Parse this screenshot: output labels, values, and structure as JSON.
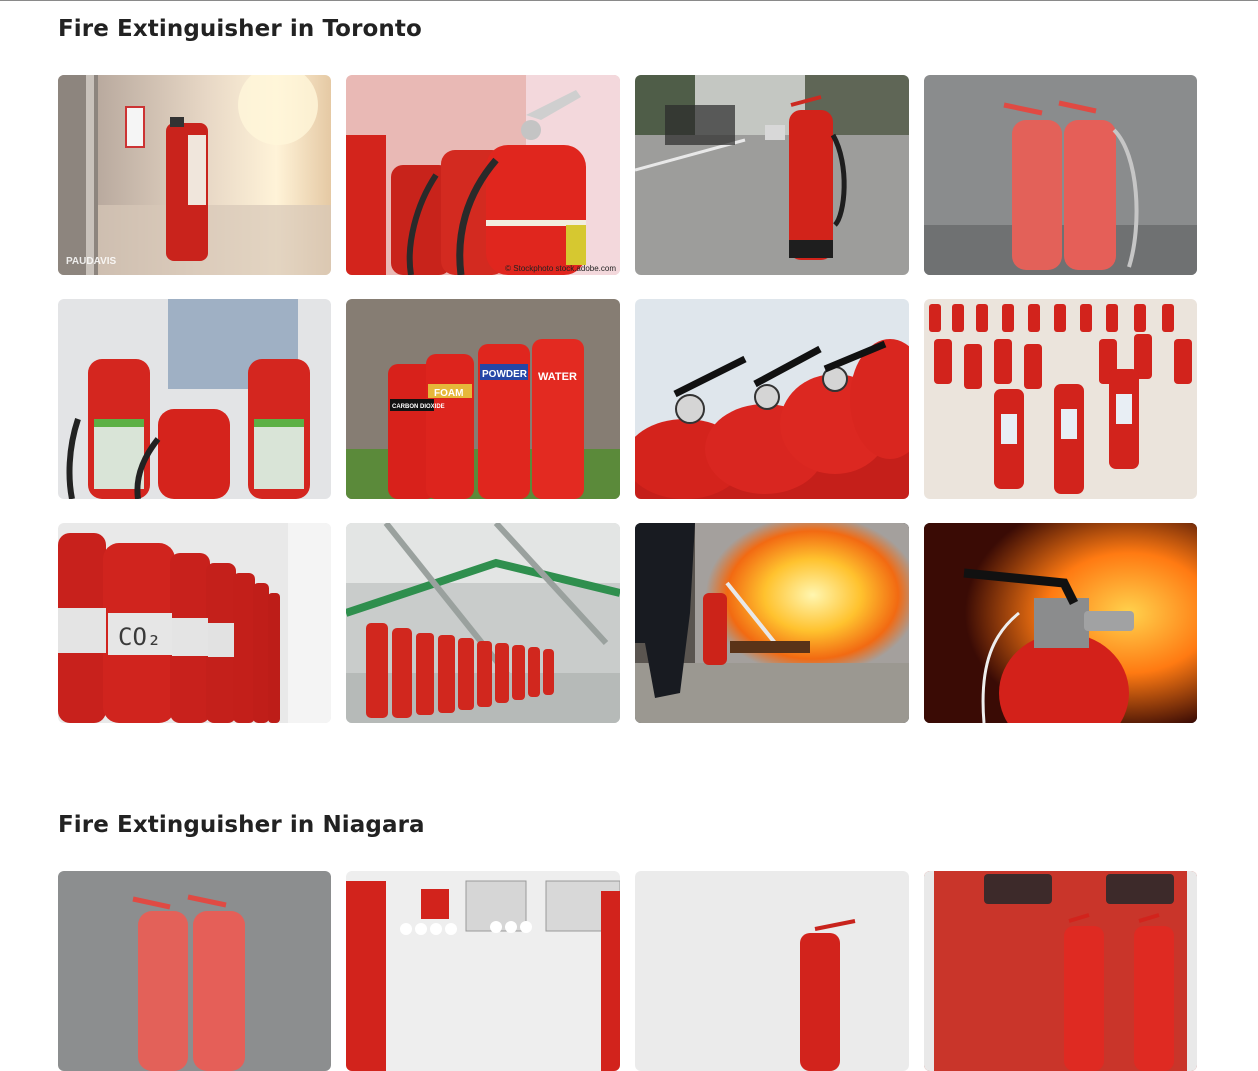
{
  "sections": [
    {
      "title": "Fire Extinguisher in Toronto",
      "images": [
        {
          "alt": "Fire extinguisher mounted on hallway wall",
          "watermark": "PAUDAVIS"
        },
        {
          "alt": "Row of red fire extinguishers",
          "watermark": "© Stockphoto  stock.adobe.com"
        },
        {
          "alt": "Fire extinguisher on road with firefighters behind"
        },
        {
          "alt": "Two red fire extinguishers against grey wall"
        },
        {
          "alt": "Inspector checking fire extinguishers"
        },
        {
          "alt": "Carbon dioxide, foam, powder and water extinguishers",
          "labels": [
            "CARBON DIOXIDE",
            "FOAM",
            "POWDER",
            "WATER"
          ]
        },
        {
          "alt": "Close-up of extinguisher handles and gauges"
        },
        {
          "alt": "Many fire extinguishers on display"
        },
        {
          "alt": "CO2 extinguisher cylinders in a row",
          "labels": [
            "CO2"
          ]
        },
        {
          "alt": "Extinguisher cylinders in an industrial room"
        },
        {
          "alt": "Person spraying extinguisher at fire"
        },
        {
          "alt": "Fire extinguisher in front of flames"
        }
      ]
    },
    {
      "title": "Fire Extinguisher in Niagara",
      "images": [
        {
          "alt": "Red extinguishers against grey wall"
        },
        {
          "alt": "Fire safety equipment display"
        },
        {
          "alt": "Extinguisher on white background"
        },
        {
          "alt": "Extinguishers in front of red cabinet"
        }
      ]
    }
  ]
}
